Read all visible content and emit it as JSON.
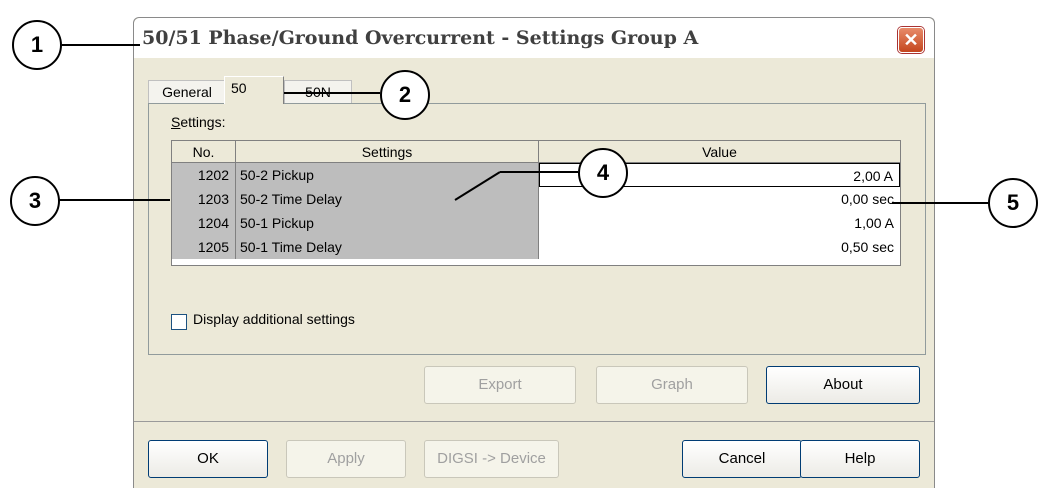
{
  "window": {
    "title": "50/51 Phase/Ground Overcurrent - Settings Group A",
    "close_icon": "close-icon"
  },
  "tabs": [
    {
      "label": "General"
    },
    {
      "label": "50"
    },
    {
      "label": "50N"
    }
  ],
  "settings_label": "Settings:",
  "table": {
    "headers": [
      "No.",
      "Settings",
      "Value"
    ],
    "rows": [
      {
        "no": "1202",
        "setting": "50-2 Pickup",
        "value": "2,00 A"
      },
      {
        "no": "1203",
        "setting": "50-2 Time Delay",
        "value": "0,00 sec"
      },
      {
        "no": "1204",
        "setting": "50-1 Pickup",
        "value": "1,00 A"
      },
      {
        "no": "1205",
        "setting": "50-1 Time Delay",
        "value": "0,50 sec"
      }
    ]
  },
  "checkbox_label": "Display additional settings",
  "buttons": {
    "export": "Export",
    "graph": "Graph",
    "about": "About",
    "ok": "OK",
    "apply": "Apply",
    "digsi": "DIGSI -> Device",
    "cancel": "Cancel",
    "help": "Help"
  },
  "callouts": [
    "1",
    "2",
    "3",
    "4",
    "5"
  ]
}
